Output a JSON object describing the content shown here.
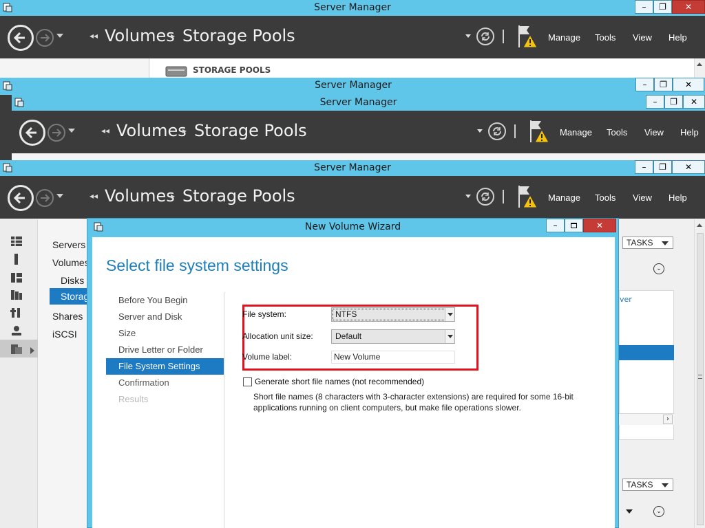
{
  "window": {
    "title": "Server Manager",
    "minimize": "–",
    "restore": "❐",
    "close": "✕"
  },
  "nav": {
    "back_chevrons": "◂◂",
    "crumb1": "Volumes",
    "sep": "▸",
    "crumb2": "Storage Pools"
  },
  "menu": {
    "manage": "Manage",
    "tools": "Tools",
    "view": "View",
    "help": "Help"
  },
  "background": {
    "section_title": "STORAGE POOLS"
  },
  "sidebar": {
    "items": [
      {
        "label": "Servers"
      },
      {
        "label": "Volumes"
      },
      {
        "label": "Disks"
      },
      {
        "label": "Storage Pools"
      },
      {
        "label": "Shares"
      },
      {
        "label": "iSCSI"
      }
    ]
  },
  "wizard": {
    "title": "New Volume Wizard",
    "heading": "Select file system settings",
    "steps": [
      {
        "label": "Before You Begin",
        "state": "done"
      },
      {
        "label": "Server and Disk",
        "state": "done"
      },
      {
        "label": "Size",
        "state": "done"
      },
      {
        "label": "Drive Letter or Folder",
        "state": "done"
      },
      {
        "label": "File System Settings",
        "state": "current"
      },
      {
        "label": "Confirmation",
        "state": "next"
      },
      {
        "label": "Results",
        "state": "disabled"
      }
    ],
    "fields": {
      "fs_label": "File system:",
      "fs_value": "NTFS",
      "alloc_label": "Allocation unit size:",
      "alloc_value": "Default",
      "vol_label": "Volume label:",
      "vol_value": "New Volume"
    },
    "short_names": {
      "checkbox_label": "Generate short file names (not recommended)",
      "checked": false,
      "desc_line1": "Short file names (8 characters with 3-character extensions) are required for some 16-bit",
      "desc_line2": "applications running on client computers, but make file operations slower."
    }
  },
  "right_panel": {
    "tasks_label": "TASKS",
    "partial_text": "ver",
    "chevron": "⌄"
  },
  "colors": {
    "titlebar": "#5fc6ea",
    "navbar": "#3b3b3b",
    "accent": "#1d7bc4",
    "highlight_box": "#e0141f",
    "close_button": "#c53b35"
  }
}
